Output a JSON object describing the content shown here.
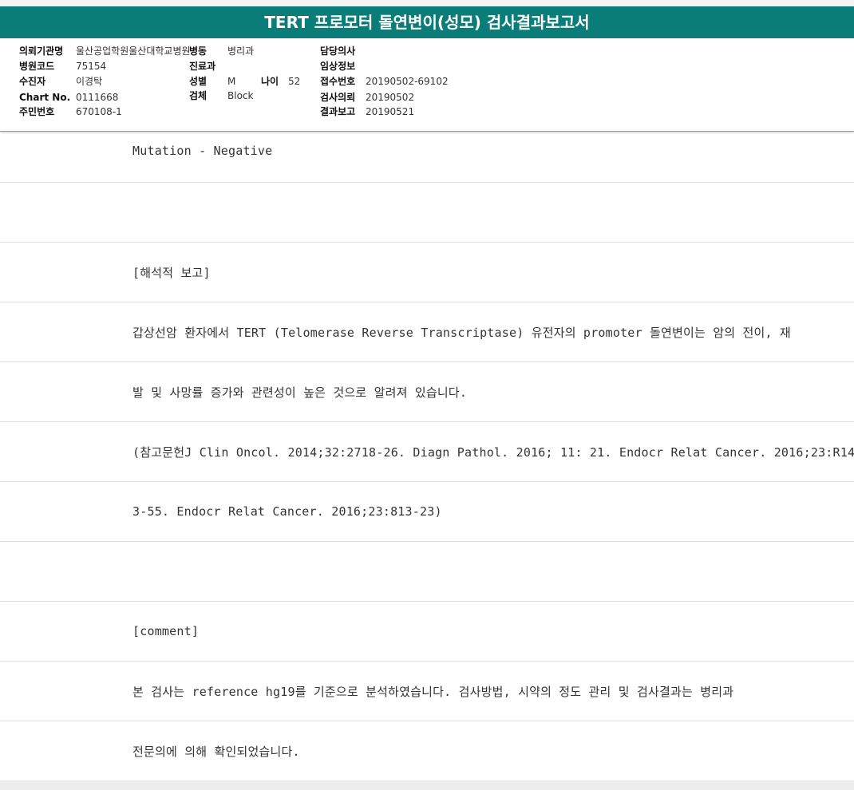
{
  "title": "TERT 프로모터 돌연변이(성모) 검사결과보고서",
  "header": {
    "institution_label": "의뢰기관명",
    "institution_value": "울산공업학원울산대학교병원",
    "ward_label": "병동",
    "ward_value": "병리과",
    "doctor_label": "담당의사",
    "doctor_value": "",
    "hospital_code_label": "병원코드",
    "hospital_code_value": "75154",
    "department_label": "진료과",
    "department_value": "",
    "clinical_info_label": "임상정보",
    "clinical_info_value": "",
    "patient_label": "수진자",
    "patient_value": "이경탁",
    "sex_label": "성별",
    "sex_value": "M",
    "age_label": "나이",
    "age_value": "52",
    "receipt_label": "접수번호",
    "receipt_value": "20190502-69102",
    "chart_label": "Chart No.",
    "chart_value": "0111668",
    "specimen_label": "검체",
    "specimen_value": "Block",
    "request_label": "검사의뢰",
    "request_value": "20190502",
    "resident_label": "주민번호",
    "resident_value": "670108-1",
    "report_label": "결과보고",
    "report_value": "20190521"
  },
  "lines": [
    "Mutation - Negative",
    "",
    "[해석적 보고]",
    "갑상선암 환자에서 TERT (Telomerase Reverse Transcriptase) 유전자의 promoter 돌연변이는 암의 전이, 재",
    "발 및 사망률 증가와 관련성이 높은 것으로 알려져 있습니다.",
    "(참고문헌J Clin Oncol. 2014;32:2718-26. Diagn Pathol. 2016; 11: 21. Endocr Relat Cancer. 2016;23:R14",
    "3-55. Endocr Relat Cancer. 2016;23:813-23)",
    "",
    "[comment]",
    "본 검사는 reference hg19를 기준으로 분석하였습니다. 검사방법, 시약의 정도 관리 및 검사결과는 병리과",
    "전문의에 의해 확인되었습니다."
  ]
}
